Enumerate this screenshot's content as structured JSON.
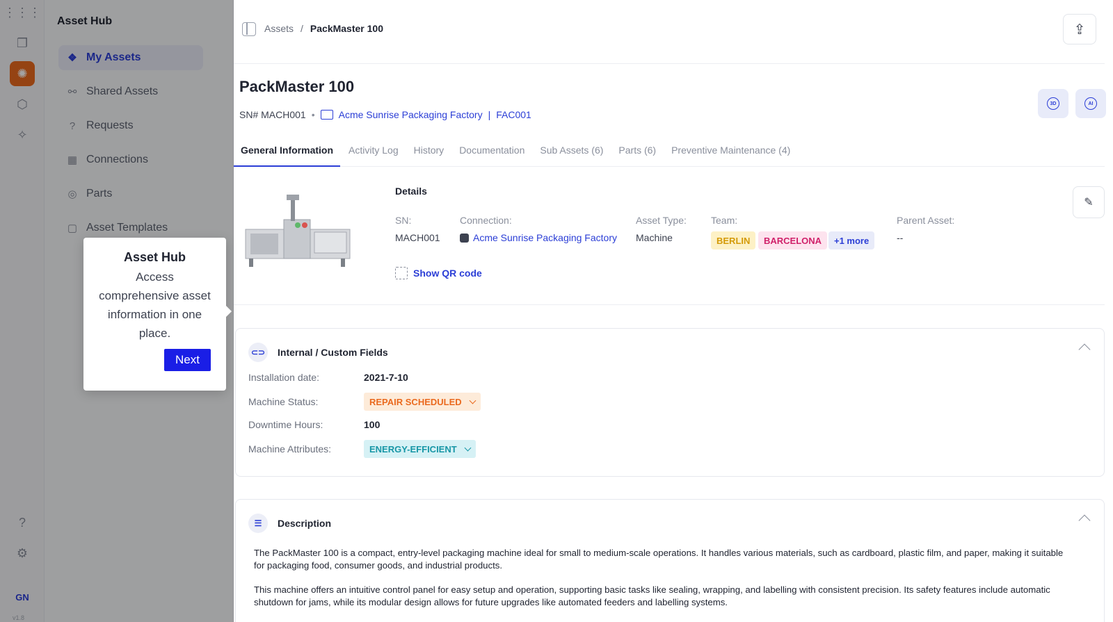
{
  "app": {
    "title": "Asset Hub",
    "user_initials": "GN",
    "version": "v1.8"
  },
  "sidebar": {
    "items": [
      {
        "label": "My Assets"
      },
      {
        "label": "Shared Assets"
      },
      {
        "label": "Requests"
      },
      {
        "label": "Connections"
      },
      {
        "label": "Parts"
      },
      {
        "label": "Asset Templates"
      }
    ]
  },
  "tooltip": {
    "title": "Asset Hub",
    "body": "Access comprehensive asset information in one place.",
    "next_label": "Next"
  },
  "breadcrumb": {
    "root": "Assets",
    "sep": "/",
    "current": "PackMaster 100"
  },
  "asset": {
    "name": "PackMaster 100",
    "sn_prefix": "SN# MACH001",
    "dot": "•",
    "factory": "Acme Sunrise Packaging Factory",
    "pipe": "|",
    "factory_code": "FAC001",
    "btn_3d": "3D",
    "btn_ai": "AI"
  },
  "tabs": [
    {
      "label": "General Information"
    },
    {
      "label": "Activity Log"
    },
    {
      "label": "History"
    },
    {
      "label": "Documentation"
    },
    {
      "label": "Sub Assets (6)"
    },
    {
      "label": "Parts (6)"
    },
    {
      "label": "Preventive Maintenance (4)"
    }
  ],
  "details": {
    "title": "Details",
    "sn_label": "SN:",
    "sn_value": "MACH001",
    "connection_label": "Connection:",
    "connection_value": "Acme Sunrise Packaging Factory",
    "type_label": "Asset Type:",
    "type_value": "Machine",
    "team_label": "Team:",
    "teams": [
      {
        "label": "BERLIN",
        "bg": "#fdf1c6",
        "fg": "#d49a07"
      },
      {
        "label": "BARCELONA",
        "bg": "#fde3ee",
        "fg": "#d0216a"
      },
      {
        "label": "+1 more",
        "bg": "#e8ebf9",
        "fg": "#2b3ed6"
      }
    ],
    "parent_label": "Parent Asset:",
    "parent_value": "--",
    "qr_label": "Show QR code"
  },
  "custom_fields": {
    "title": "Internal / Custom Fields",
    "installation_label": "Installation date:",
    "installation_value": "2021-7-10",
    "status_label": "Machine Status:",
    "status_value": "REPAIR SCHEDULED",
    "downtime_label": "Downtime Hours:",
    "downtime_value": "100",
    "attributes_label": "Machine Attributes:",
    "attributes_value": "ENERGY-EFFICIENT",
    "colors": {
      "status_bg": "#fdebd9",
      "status_fg": "#ea6a1f",
      "attr_bg": "#d6f1f5",
      "attr_fg": "#1796a6"
    }
  },
  "description": {
    "title": "Description",
    "p1": "The PackMaster 100 is a compact, entry-level packaging machine ideal for small to medium-scale operations. It handles various materials, such as cardboard, plastic film, and paper, making it suitable for packaging food, consumer goods, and industrial products.",
    "p2": "This machine offers an intuitive control panel for easy setup and operation, supporting basic tasks like sealing, wrapping, and labelling with consistent precision. Its safety features include automatic shutdown for jams, while its modular design allows for future upgrades like automated feeders and labelling systems."
  },
  "colors": {
    "accent": "#2b3ed6",
    "brand_orange": "#ea6a1f"
  }
}
